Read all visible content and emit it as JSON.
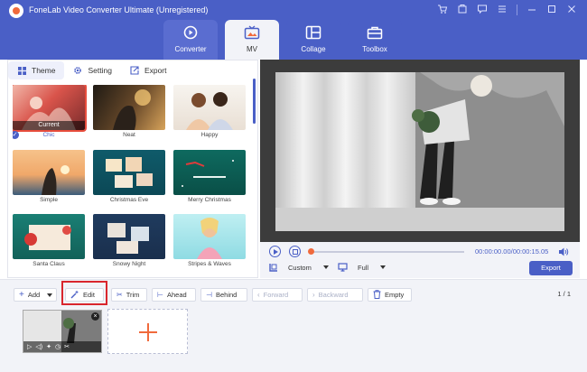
{
  "app": {
    "title": "FoneLab Video Converter Ultimate (Unregistered)"
  },
  "nav_tabs": [
    {
      "label": "Converter",
      "icon": "converter-icon"
    },
    {
      "label": "MV",
      "icon": "mv-icon",
      "active": true
    },
    {
      "label": "Collage",
      "icon": "collage-icon"
    },
    {
      "label": "Toolbox",
      "icon": "toolbox-icon"
    }
  ],
  "panel_tabs": {
    "theme": "Theme",
    "setting": "Setting",
    "export": "Export"
  },
  "themes": {
    "current_badge": "Current",
    "items": [
      {
        "label": "Chic"
      },
      {
        "label": "Neat"
      },
      {
        "label": "Happy"
      },
      {
        "label": "Simple"
      },
      {
        "label": "Christmas Eve"
      },
      {
        "label": "Merry Christmas"
      },
      {
        "label": "Santa Claus"
      },
      {
        "label": "Snowy Night"
      },
      {
        "label": "Stripes & Waves"
      }
    ]
  },
  "player": {
    "time": "00:00:00.00/00:00:15.05",
    "aspect": "Custom",
    "mode": "Full",
    "export_label": "Export"
  },
  "toolbar": {
    "add": "Add",
    "edit": "Edit",
    "trim": "Trim",
    "ahead": "Ahead",
    "behind": "Behind",
    "forward": "Forward",
    "backward": "Backward",
    "empty": "Empty",
    "pager": "1 / 1"
  },
  "colors": {
    "accent": "#4a5fc6",
    "highlight": "#d9262d",
    "orange": "#f06a3c"
  }
}
